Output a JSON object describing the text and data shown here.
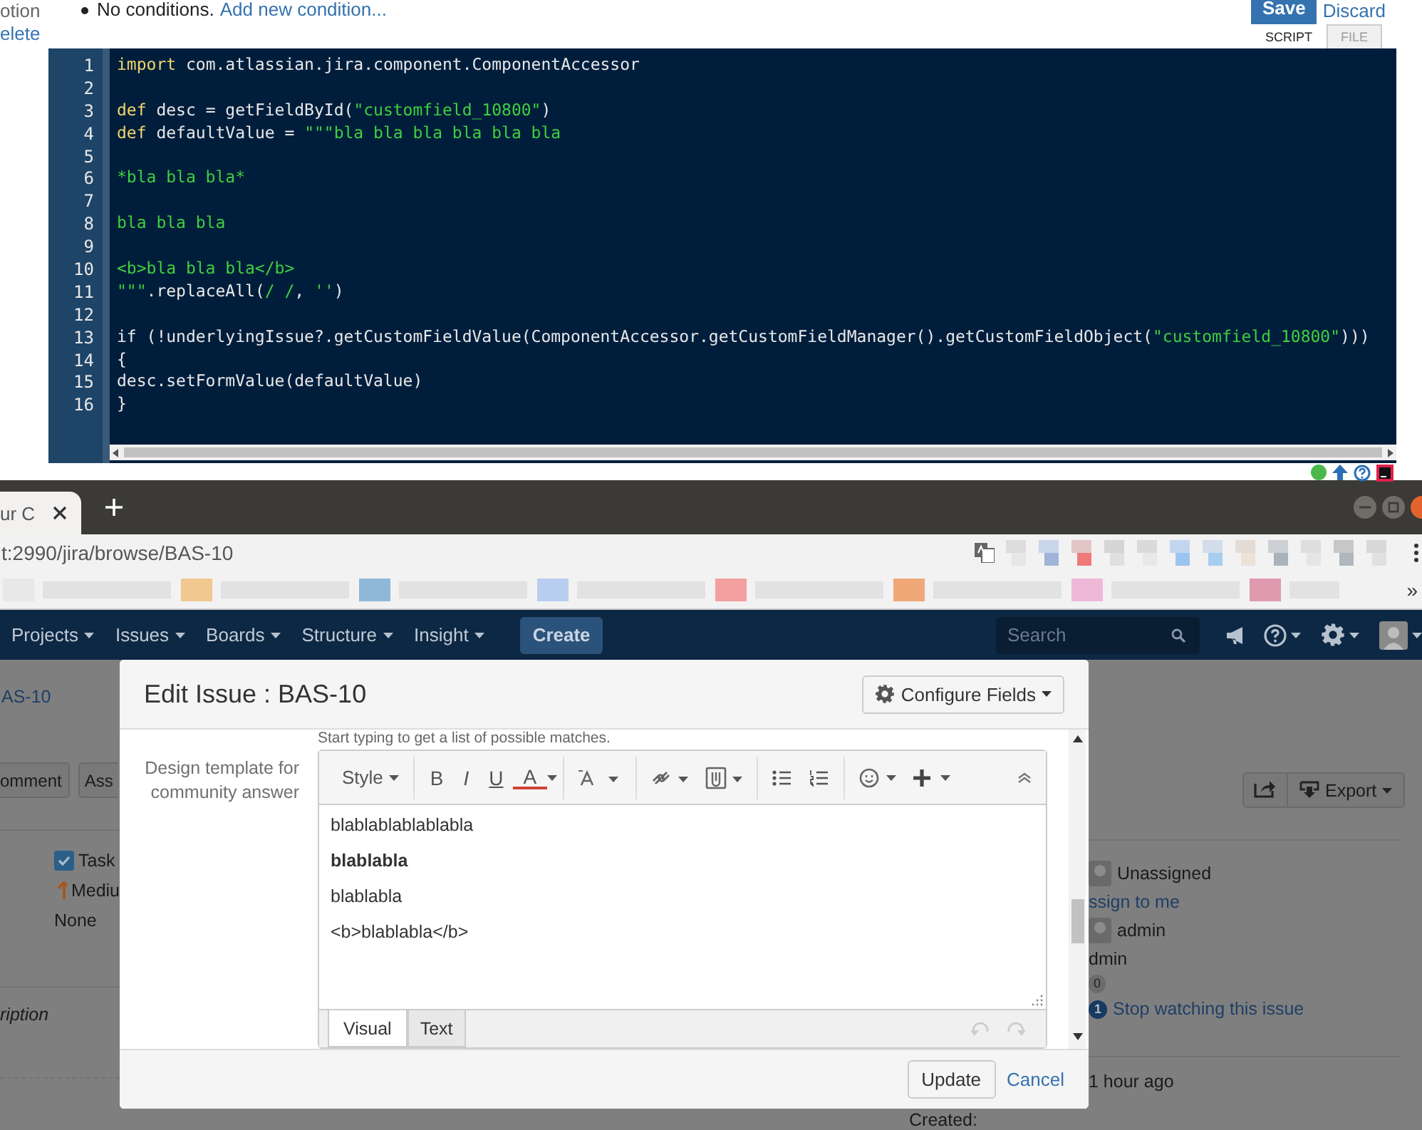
{
  "script_panel": {
    "side_links": [
      {
        "text": "otion",
        "kind": "text"
      },
      {
        "text": "elete",
        "kind": "link"
      }
    ],
    "conditions": {
      "text": "No conditions.",
      "link": "Add new condition..."
    },
    "save": "Save",
    "discard": "Discard",
    "tabs": [
      {
        "label": "SCRIPT",
        "selected": true
      },
      {
        "label": "FILE",
        "selected": false
      }
    ],
    "code_lines": [
      {
        "number": "1",
        "tokens": [
          {
            "kind": "keyword",
            "text": "import"
          },
          {
            "kind": "plain",
            "text": " com.atlassian.jira.component.ComponentAccessor"
          }
        ]
      },
      {
        "number": "2"
      },
      {
        "number": "3",
        "tokens": [
          {
            "kind": "keyword",
            "text": "def"
          },
          {
            "kind": "plain",
            "text": " desc = getFieldById("
          },
          {
            "kind": "string",
            "text": "\"customfield_10800\""
          },
          {
            "kind": "plain",
            "text": ")"
          }
        ]
      },
      {
        "number": "4",
        "tokens": [
          {
            "kind": "keyword",
            "text": "def"
          },
          {
            "kind": "plain",
            "text": " defaultValue = "
          },
          {
            "kind": "string",
            "text": "\"\"\"bla bla bla bla bla bla"
          }
        ]
      },
      {
        "number": "5"
      },
      {
        "number": "6",
        "tokens": [
          {
            "kind": "string",
            "text": "*bla bla bla*"
          }
        ]
      },
      {
        "number": "7"
      },
      {
        "number": "8",
        "tokens": [
          {
            "kind": "string",
            "text": "bla bla bla"
          }
        ]
      },
      {
        "number": "9"
      },
      {
        "number": "10",
        "tokens": [
          {
            "kind": "string",
            "text": "<b>bla bla bla</b>"
          }
        ]
      },
      {
        "number": "11",
        "tokens": [
          {
            "kind": "string",
            "text": "\"\"\""
          },
          {
            "kind": "plain",
            "text": ".replaceAll("
          },
          {
            "kind": "string",
            "text": "/ /"
          },
          {
            "kind": "plain",
            "text": ", "
          },
          {
            "kind": "string",
            "text": "''"
          },
          {
            "kind": "plain",
            "text": ")"
          }
        ]
      },
      {
        "number": "12"
      },
      {
        "number": "13",
        "tokens": [
          {
            "kind": "plain",
            "text": "if (!underlyingIssue?.getCustomFieldValue(ComponentAccessor.getCustomFieldManager().getCustomFieldObject("
          },
          {
            "kind": "string",
            "text": "\"customfield_10800\""
          },
          {
            "kind": "plain",
            "text": ")))"
          }
        ]
      },
      {
        "number": "14",
        "tokens": [
          {
            "kind": "plain",
            "text": "{"
          }
        ]
      },
      {
        "number": "15",
        "tokens": [
          {
            "kind": "plain",
            "text": "desc.setFormValue(defaultValue)"
          }
        ]
      },
      {
        "number": "16",
        "tokens": [
          {
            "kind": "plain",
            "text": "}"
          }
        ]
      }
    ]
  },
  "browser": {
    "tab_title": "ur C",
    "url": "t:2990/jira/browse/BAS-10",
    "bookmarks_more": "»"
  },
  "nav": {
    "items": [
      "Projects",
      "Issues",
      "Boards",
      "Structure",
      "Insight"
    ],
    "create": "Create",
    "search": {
      "placeholder": "Search"
    }
  },
  "issue_page": {
    "key": "AS-10",
    "buttons": [
      "omment",
      "Ass"
    ],
    "details": [
      {
        "kind": "type",
        "text": "Task"
      },
      {
        "kind": "priority",
        "text": "Mediu"
      },
      {
        "kind": "plain",
        "text": "None"
      }
    ],
    "description_label": "ription",
    "export": "Export",
    "assignee": "Unassigned",
    "assign_link": "ssign to me",
    "reporter": "admin",
    "reporter_2": "dmin",
    "votes": "0",
    "watchers": "1",
    "watch_link": "Stop watching this issue",
    "created_label": "Created:",
    "created_value": "1 hour ago"
  },
  "dialog": {
    "title": "Edit Issue : BAS-10",
    "configure": "Configure Fields",
    "hint": "Start typing to get a list of possible matches.",
    "field_label": "Design template for community answer",
    "style": "Style",
    "format_buttons": [
      "B",
      "I",
      "U",
      "A"
    ],
    "paragraphs": [
      {
        "text": "blablablablablabla",
        "bold": false
      },
      {
        "text": "blablabla",
        "bold": true
      },
      {
        "text": "blablabla",
        "bold": false
      },
      {
        "text": "<b>blablabla</b>",
        "bold": false
      }
    ],
    "editor_tabs": [
      {
        "label": "Visual",
        "selected": true
      },
      {
        "label": "Text",
        "selected": false
      }
    ],
    "update": "Update",
    "cancel": "Cancel"
  }
}
